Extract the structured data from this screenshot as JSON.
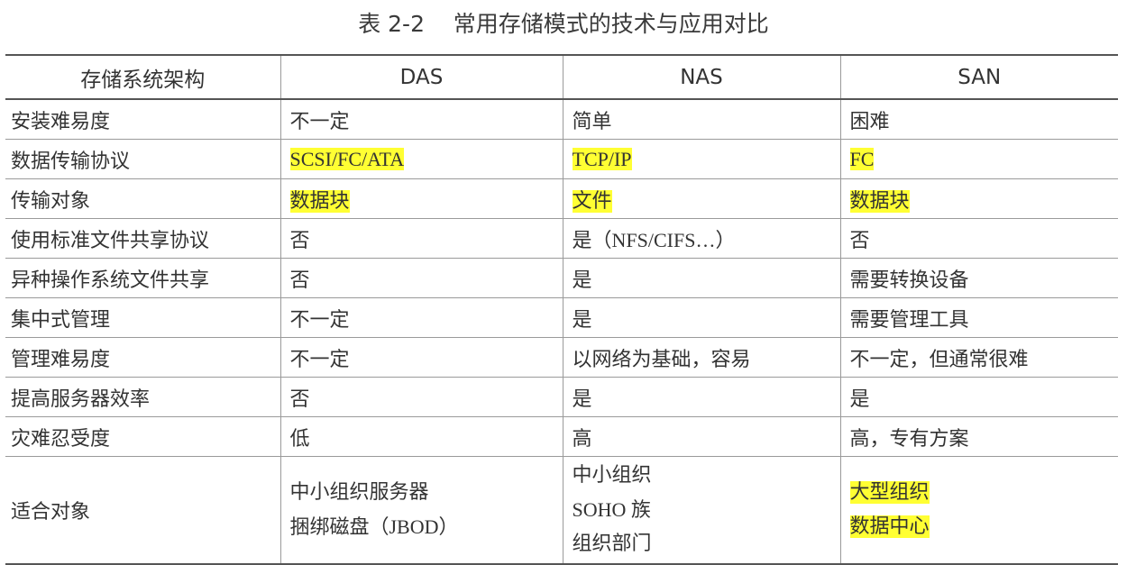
{
  "caption": "表 2-2    常用存储模式的技术与应用对比",
  "colors": {
    "highlight": "#ffff33",
    "border": "#9a9a9a",
    "rule": "#555555",
    "text": "#333333"
  },
  "table": {
    "headers": [
      "存储系统架构",
      "DAS",
      "NAS",
      "SAN"
    ],
    "rows": [
      [
        "安装难易度",
        "不一定",
        "简单",
        "困难"
      ],
      [
        "数据传输协议",
        "SCSI/FC/ATA",
        "TCP/IP",
        "FC"
      ],
      [
        "传输对象",
        "数据块",
        "文件",
        "数据块"
      ],
      [
        "使用标准文件共享协议",
        "否",
        "是（NFS/CIFS…）",
        "否"
      ],
      [
        "异种操作系统文件共享",
        "否",
        "是",
        "需要转换设备"
      ],
      [
        "集中式管理",
        "不一定",
        "是",
        "需要管理工具"
      ],
      [
        "管理难易度",
        "不一定",
        "以网络为基础，容易",
        "不一定，但通常很难"
      ],
      [
        "提高服务器效率",
        "否",
        "是",
        "是"
      ],
      [
        "灾难忍受度",
        "低",
        "高",
        "高，专有方案"
      ]
    ],
    "last_row": {
      "label": "适合对象",
      "das": [
        "中小组织服务器",
        "捆绑磁盘（JBOD）"
      ],
      "nas": [
        "中小组织",
        "SOHO 族",
        "组织部门"
      ],
      "san": [
        "大型组织",
        "数据中心"
      ]
    },
    "highlighted_cells": [
      "row1.col1",
      "row1.col2",
      "row1.col3",
      "row2.col1",
      "row2.col2",
      "row2.col3",
      "last_row.san"
    ]
  }
}
